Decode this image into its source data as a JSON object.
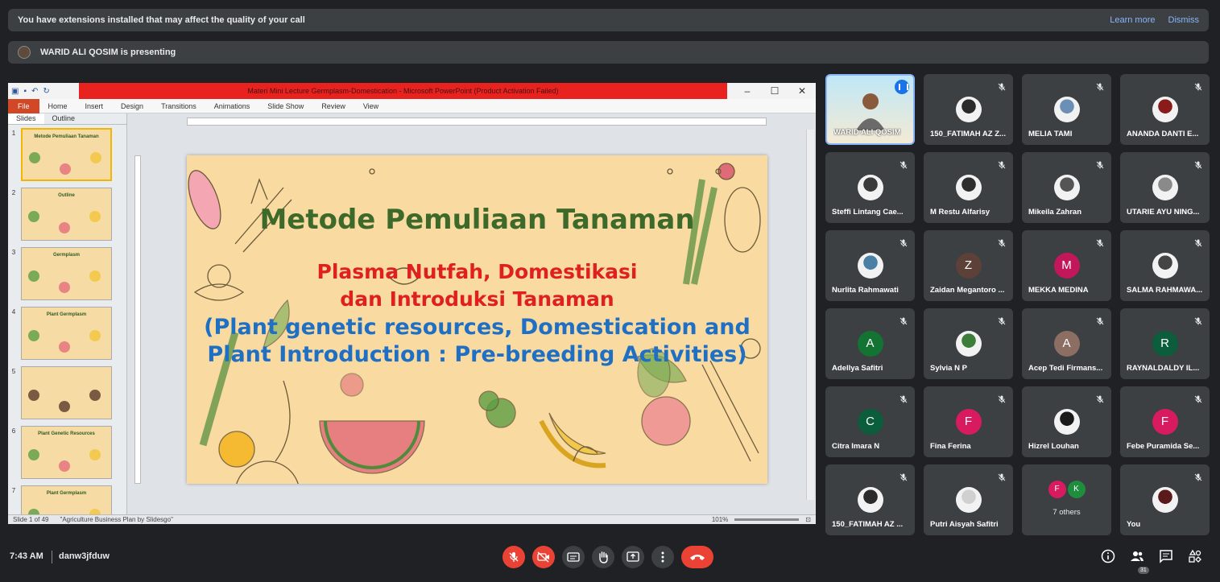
{
  "banner": {
    "warning": "You have extensions installed that may affect the quality of your call",
    "learn_more": "Learn more",
    "dismiss": "Dismiss"
  },
  "presenting": "WARID ALI QOSIM is presenting",
  "ppt": {
    "window_title": "Materi Mini Lecture Germplasm-Domestication - Microsoft PowerPoint (Product Activation Failed)",
    "ribbon": [
      "File",
      "Home",
      "Insert",
      "Design",
      "Transitions",
      "Animations",
      "Slide Show",
      "Review",
      "View"
    ],
    "panel_tabs": [
      "Slides",
      "Outline"
    ],
    "slide_numbers": [
      "1",
      "2",
      "3",
      "4",
      "5",
      "6",
      "7"
    ],
    "thumb_titles": [
      "Metode Pemuliaan Tanaman",
      "Outline",
      "Germplasm",
      "Plant Germplasm",
      "",
      "Plant Genetic Resources",
      "Plant Germplasm"
    ],
    "status_slide": "Slide 1 of 49",
    "status_theme": "\"Agriculture Business Plan by Slidesgo\"",
    "zoom": "101%",
    "slide": {
      "title": "Metode Pemuliaan Tanaman",
      "sub1": "Plasma Nutfah, Domestikasi",
      "sub2": "dan Introduksi Tanaman",
      "en1": "(Plant genetic resources, Domestication and",
      "en2": "Plant Introduction : Pre-breeding Activities)"
    }
  },
  "participants": [
    {
      "name": "WARID ALI QOSIM",
      "type": "featured"
    },
    {
      "name": "150_FATIMAH AZ Z...",
      "type": "photo",
      "color": "#2b2b2b"
    },
    {
      "name": "MELIA TAMI",
      "type": "photo",
      "color": "#6b8fb5"
    },
    {
      "name": "ANANDA DANTI E...",
      "type": "photo",
      "color": "#8b1a1a"
    },
    {
      "name": "Steffi Lintang Cae...",
      "type": "photo",
      "color": "#3a3a3a"
    },
    {
      "name": "M Restu Alfarisy",
      "type": "photo",
      "color": "#2e2e2e"
    },
    {
      "name": "Mikeila Zahran",
      "type": "photo",
      "color": "#555555"
    },
    {
      "name": "UTARIE AYU NING...",
      "type": "photo",
      "color": "#8a8a8a"
    },
    {
      "name": "Nurlita Rahmawati",
      "type": "photo",
      "color": "#4a7fa6"
    },
    {
      "name": "Zaidan Megantoro ...",
      "type": "letter",
      "letter": "Z",
      "color": "#5d4037"
    },
    {
      "name": "MEKKA MEDINA",
      "type": "letter",
      "letter": "M",
      "color": "#c2185b"
    },
    {
      "name": "SALMA RAHMAWA...",
      "type": "photo",
      "color": "#444444"
    },
    {
      "name": "Adellya Safitri",
      "type": "letter",
      "letter": "A",
      "color": "#137333"
    },
    {
      "name": "Sylvia N P",
      "type": "photo",
      "color": "#3c7d3a"
    },
    {
      "name": "Acep Tedi Firmans...",
      "type": "letter",
      "letter": "A",
      "color": "#8d6e63"
    },
    {
      "name": "RAYNALDALDY IL...",
      "type": "letter",
      "letter": "R",
      "color": "#0b5d3b"
    },
    {
      "name": "Citra Imara N",
      "type": "letter",
      "letter": "C",
      "color": "#0b5d3b"
    },
    {
      "name": "Fina Ferina",
      "type": "letter",
      "letter": "F",
      "color": "#d81b60"
    },
    {
      "name": "Hizrel Louhan",
      "type": "photo",
      "color": "#1a1a1a"
    },
    {
      "name": "Febe Puramida Se...",
      "type": "letter",
      "letter": "F",
      "color": "#d81b60"
    },
    {
      "name": "150_FATIMAH AZ ...",
      "type": "photo",
      "color": "#2b2b2b"
    },
    {
      "name": "Putri Aisyah Safitri",
      "type": "photo",
      "color": "#d0d0d0"
    },
    {
      "name": "7 others",
      "type": "others",
      "letters": [
        "F",
        "K"
      ],
      "colors": [
        "#d81b60",
        "#1e8e3e"
      ]
    },
    {
      "name": "You",
      "type": "photo",
      "color": "#5a1a1a"
    }
  ],
  "bottom": {
    "time": "7:43 AM",
    "meeting_code": "danw3jfduw",
    "people_count": "31"
  },
  "colors": {
    "meet_bg": "#202124",
    "tile_bg": "#3c4043",
    "accent_blue": "#8ab4f8",
    "end_call_red": "#ea4335"
  }
}
